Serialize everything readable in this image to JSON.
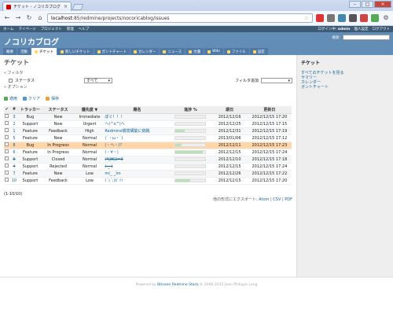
{
  "browser": {
    "tab_title": "チケット - ノコリカブログ - Redmine",
    "url_host": "localhost",
    "url_path": ":85/redmine/projects/nocoricablog/issues",
    "colors": {
      "chrome": "#b7c9e4"
    }
  },
  "topmenu": {
    "left": [
      "ホーム",
      "マイページ",
      "プロジェクト",
      "管理",
      "ヘルプ"
    ],
    "login_label": "ログイン中:",
    "user": "admin",
    "right": [
      "個人設定",
      "ログアウト"
    ]
  },
  "header": {
    "project_title": "ノコリカブログ",
    "search_label": "検索:"
  },
  "mainmenu": [
    "概要",
    "活動",
    "チケット",
    "新しいチケット",
    "ガントチャート",
    "カレンダー",
    "ニュース",
    "文書",
    "Wiki",
    "ファイル",
    "設定"
  ],
  "main": {
    "title": "チケット",
    "filter_legend": "« フィルタ",
    "filter_status_label": "ステータス",
    "filter_status_value": "すべて",
    "add_filter_label": "フィルタ追加",
    "options_legend": "» オプション",
    "apply_label": "適用",
    "clear_label": "クリア",
    "save_label": "保存",
    "columns": [
      "#",
      "トラッカー",
      "ステータス",
      "優先度 ▼",
      "題名",
      "進捗 %",
      "期日",
      "更新日"
    ],
    "issues": [
      {
        "id": "3",
        "tracker": "Bug",
        "status": "New",
        "priority": "Immediate",
        "subject": "ぽぐ！！！",
        "progress": 0,
        "due": "2012/12/16",
        "updated": "2012/12/15 17:20",
        "closed": false
      },
      {
        "id": "2",
        "tracker": "Support",
        "status": "New",
        "priority": "Urgent",
        "subject": "ヘ(^o^)ヘ",
        "progress": 0,
        "due": "2012/12/25",
        "updated": "2012/12/15 17:15",
        "closed": false
      },
      {
        "id": "1",
        "tracker": "Feature",
        "status": "Feedback",
        "priority": "High",
        "subject": "Redmine環境構築に挑戦",
        "progress": 30,
        "due": "2012/12/31",
        "updated": "2012/12/15 17:19",
        "closed": false
      },
      {
        "id": "5",
        "tracker": "Feature",
        "status": "New",
        "priority": "Normal",
        "subject": "(´・ω・`)",
        "progress": 0,
        "due": "2013/01/06",
        "updated": "2012/12/15 17:12",
        "closed": false
      },
      {
        "id": "8",
        "tracker": "Bug",
        "status": "In Progress",
        "priority": "Normal",
        "subject": "(・ヘ・)?",
        "progress": 20,
        "due": "2012/12/11",
        "updated": "2012/12/15 17:23",
        "closed": false
      },
      {
        "id": "6",
        "tracker": "Feature",
        "status": "In Progress",
        "priority": "Normal",
        "subject": "(・∀・)",
        "progress": 90,
        "due": "2012/12/15",
        "updated": "2012/12/15 17:24",
        "closed": false
      },
      {
        "id": "9",
        "tracker": "Support",
        "status": "Closed",
        "priority": "Normal",
        "subject": "(*ﾟ∀ﾟ)=3",
        "progress": 0,
        "due": "2012/12/10",
        "updated": "2012/12/15 17:18",
        "closed": true
      },
      {
        "id": "4",
        "tracker": "Support",
        "status": "Rejected",
        "priority": "Normal",
        "subject": "(-_-)",
        "progress": 0,
        "due": "2012/12/15",
        "updated": "2012/12/15 17:24",
        "closed": true
      },
      {
        "id": "7",
        "tracker": "Feature",
        "status": "New",
        "priority": "Low",
        "subject": "m(_ _)m",
        "progress": 0,
        "due": "2012/12/26",
        "updated": "2012/12/15 17:22",
        "closed": false
      },
      {
        "id": "10",
        "tracker": "Support",
        "status": "Feedback",
        "priority": "Low",
        "subject": "(´ｪ`;)ﾎﾞｿｯ",
        "progress": 50,
        "due": "2012/12/15",
        "updated": "2012/12/15 17:20",
        "closed": false
      }
    ],
    "pager": "(1-10/10)",
    "export_label": "他の形式にエクスポート:",
    "export_atom": "Atom",
    "export_csv": "CSV",
    "export_pdf": "PDF"
  },
  "sidebar": {
    "title": "チケット",
    "links": [
      "すべてのチケットを見る",
      "サマリー",
      "カレンダー",
      "ガントチャート"
    ]
  },
  "footer": {
    "powered": "Powered by",
    "link": "Bitnami Redmine Stack",
    "copy": "© 2006-2012 Jean-Philippe Lang"
  }
}
